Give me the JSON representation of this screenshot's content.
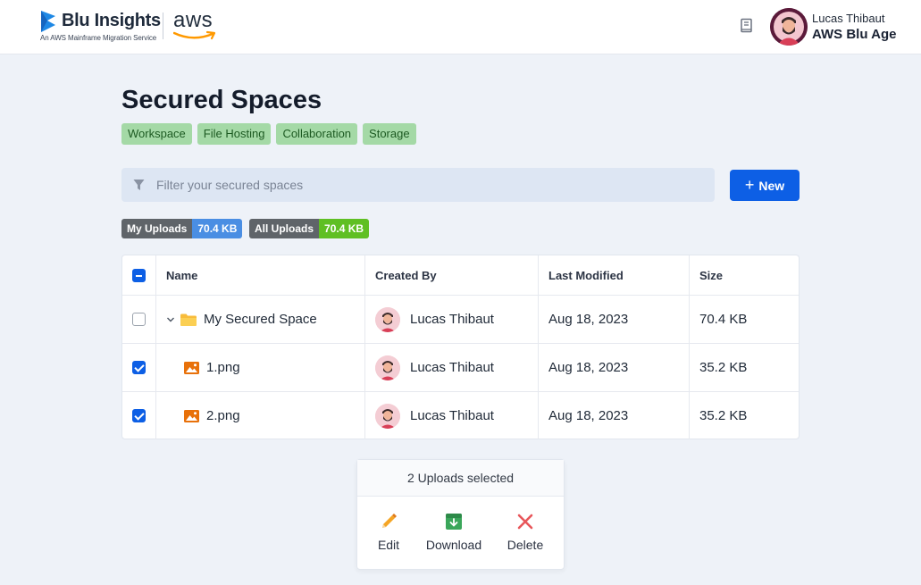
{
  "header": {
    "brand_name": "Blu Insights",
    "brand_tagline": "An AWS Mainframe Migration Service",
    "partner_logo": "aws",
    "docs_icon": "book-icon",
    "user": {
      "name": "Lucas Thibaut",
      "org": "AWS Blu Age"
    }
  },
  "page": {
    "title": "Secured Spaces",
    "tags": [
      "Workspace",
      "File Hosting",
      "Collaboration",
      "Storage"
    ]
  },
  "filter": {
    "placeholder": "Filter your secured spaces",
    "value": ""
  },
  "new_button": {
    "label": "New",
    "icon": "plus-icon"
  },
  "usage": {
    "my_uploads": {
      "label": "My Uploads",
      "value": "70.4 KB",
      "color": "#4a8ee3"
    },
    "all_uploads": {
      "label": "All Uploads",
      "value": "70.4 KB",
      "color": "#5fbf23"
    }
  },
  "table": {
    "columns": [
      "Name",
      "Created By",
      "Last Modified",
      "Size"
    ],
    "rows": [
      {
        "type": "folder",
        "name": "My Secured Space",
        "created_by": "Lucas Thibaut",
        "last_modified": "Aug 18, 2023",
        "size": "70.4 KB",
        "checked": false,
        "expanded": true
      },
      {
        "type": "image",
        "name": "1.png",
        "created_by": "Lucas Thibaut",
        "last_modified": "Aug 18, 2023",
        "size": "35.2 KB",
        "checked": true
      },
      {
        "type": "image",
        "name": "2.png",
        "created_by": "Lucas Thibaut",
        "last_modified": "Aug 18, 2023",
        "size": "35.2 KB",
        "checked": true
      }
    ]
  },
  "selection_bar": {
    "title": "2 Uploads selected",
    "actions": [
      {
        "label": "Edit",
        "icon": "pencil-icon"
      },
      {
        "label": "Download",
        "icon": "download-icon"
      },
      {
        "label": "Delete",
        "icon": "close-icon"
      }
    ]
  },
  "colors": {
    "primary": "#0d5fe5",
    "tag_bg": "#a4d9a6",
    "tag_text": "#1d5a22",
    "delete": "#e8565a"
  }
}
